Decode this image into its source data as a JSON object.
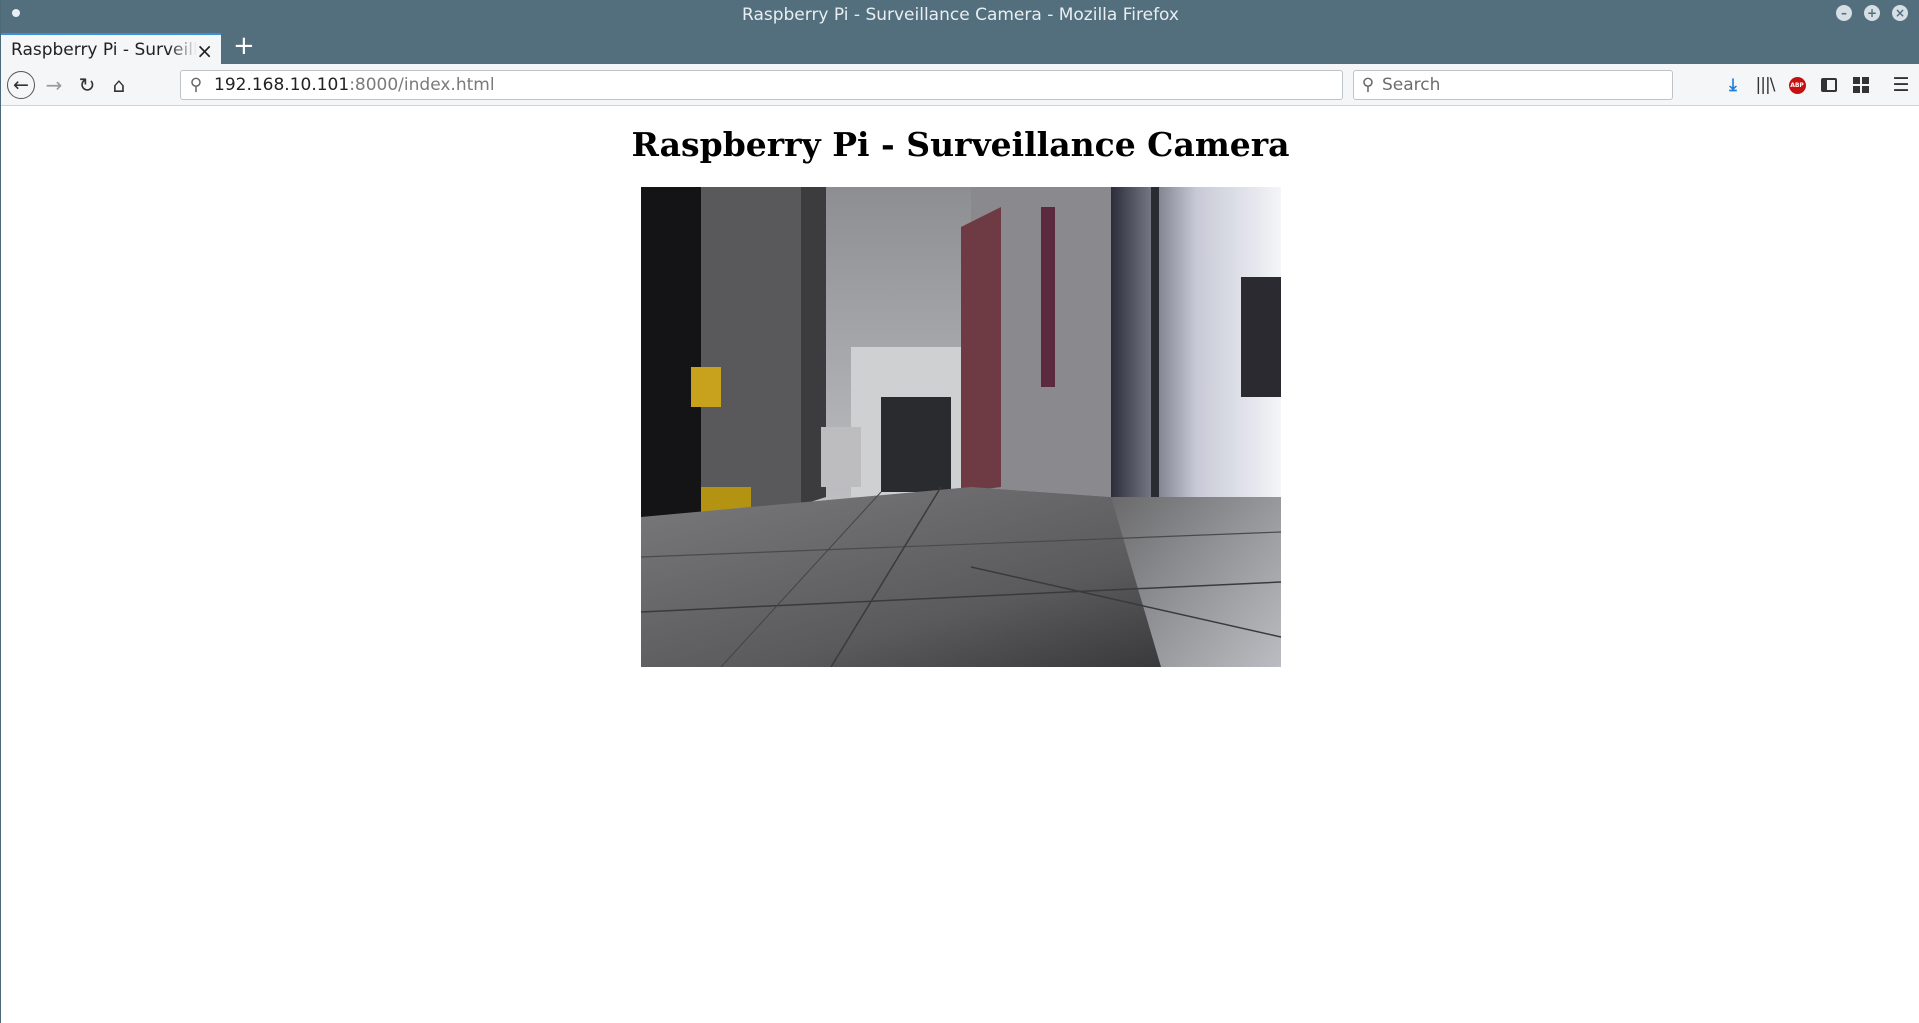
{
  "window": {
    "title": "Raspberry Pi - Surveillance Camera - Mozilla Firefox"
  },
  "tabs": [
    {
      "label": "Raspberry Pi - Surveillance Camera"
    }
  ],
  "nav": {
    "url_host": "192.168.10.101",
    "url_path": ":8000/index.html",
    "search_placeholder": "Search"
  },
  "toolbar_icons": [
    "download-icon",
    "library-icon",
    "adblock-icon",
    "sidebar-icon",
    "extensions-icon",
    "hamburger-menu-icon"
  ],
  "page": {
    "heading": "Raspberry Pi - Surveillance Camera",
    "adblock_badge": "ABP"
  }
}
